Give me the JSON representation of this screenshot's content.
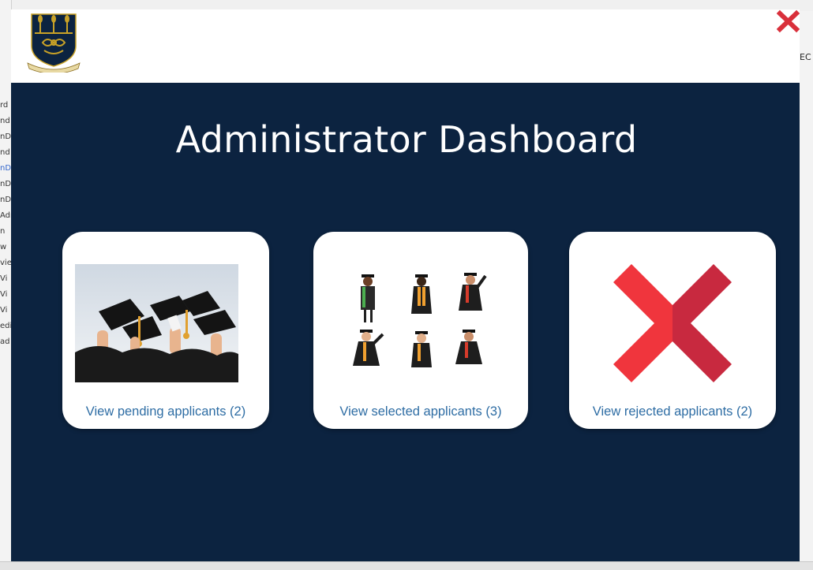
{
  "background": {
    "left_fragments": [
      "rd",
      "nd",
      "nD",
      "nd",
      "nD",
      "nD",
      "nD",
      "Adr",
      "n",
      "w",
      "vie",
      "Vi",
      "Vi",
      "Vi",
      "edi",
      "ad"
    ],
    "right_fragment": "EC"
  },
  "dashboard": {
    "title": "Administrator Dashboard",
    "cards": {
      "pending": {
        "label": "View pending applicants (2)",
        "image": "graduation-caps-photo"
      },
      "selected": {
        "label": "View selected applicants (3)",
        "image": "graduates-illustration"
      },
      "rejected": {
        "label": "View rejected applicants (2)",
        "image": "red-x-icon"
      }
    }
  },
  "colors": {
    "background": "#0c2340",
    "link": "#2e6da4",
    "close": "#d9303b",
    "reject_left": "#f0353d",
    "reject_right": "#c8293f"
  }
}
